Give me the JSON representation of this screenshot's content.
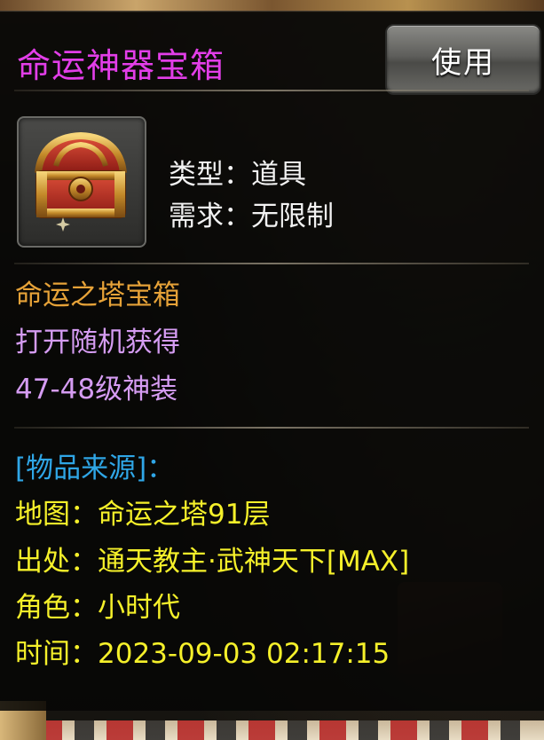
{
  "item": {
    "name": "命运神器宝箱",
    "use_label": "使用",
    "type_line": "类型：道具",
    "requirement_line": "需求：无限制",
    "description": [
      "命运之塔宝箱",
      "打开随机获得",
      "47-48级神装"
    ],
    "icon": "treasure-chest-icon"
  },
  "source": {
    "header": "[物品来源]：",
    "map_line": "地图：命运之塔91层",
    "origin_line": "出处：通天教主·武神天下[MAX]",
    "character_line": "角色：小时代",
    "time_line": "时间：2023-09-03 02:17:15"
  },
  "colors": {
    "title": "#e23ee8",
    "description_gold": "#e6a238",
    "description_purple": "#d59cf2",
    "source_header": "#2fa6e6",
    "source_text": "#f5f02a"
  }
}
